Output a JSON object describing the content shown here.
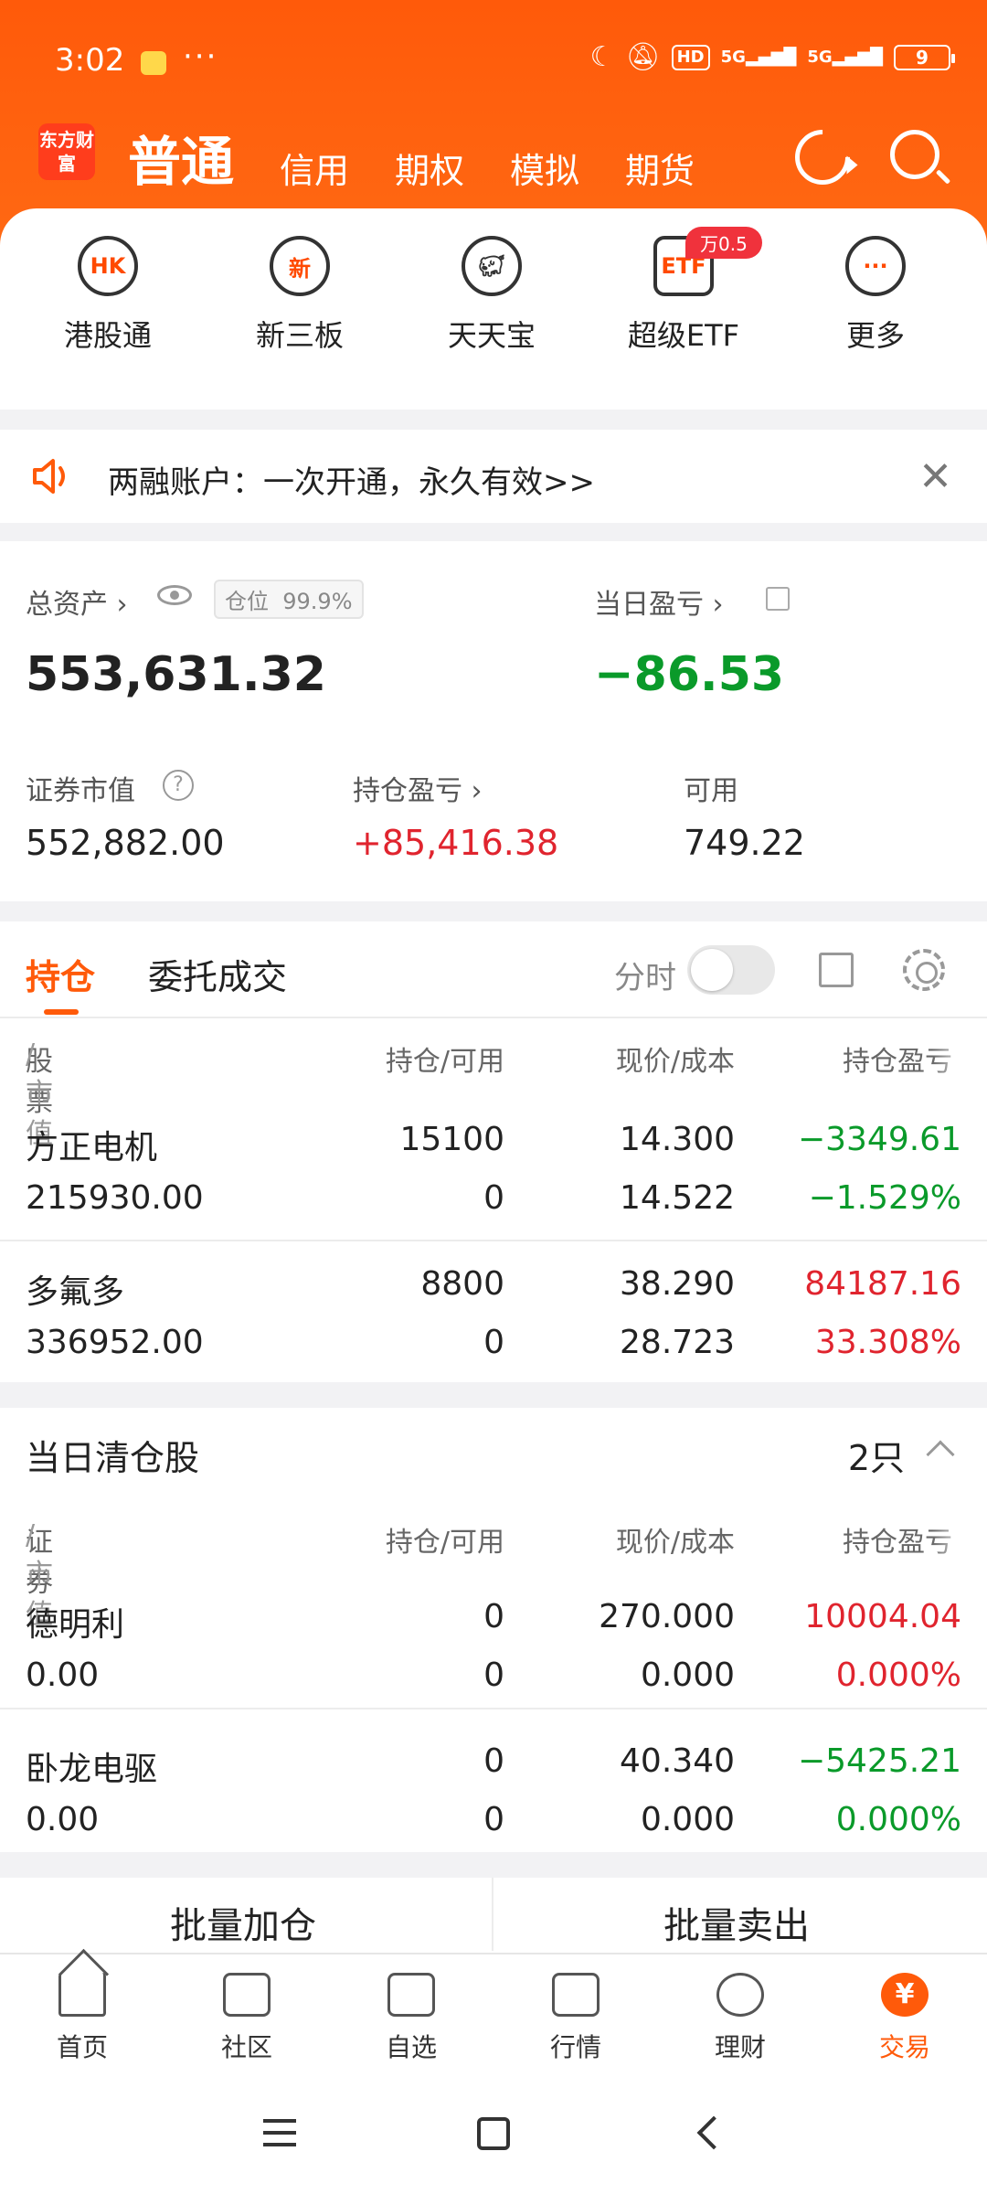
{
  "status_bar": {
    "time": "3:02",
    "dots": "···",
    "hd": "HD",
    "signal1": "5G",
    "signal2": "5G",
    "battery": "9"
  },
  "top_nav": {
    "logo": "东方财富",
    "tabs": [
      "普通",
      "信用",
      "期权",
      "模拟",
      "期货"
    ]
  },
  "quick_actions": [
    {
      "label": "港股通",
      "icon": "HK"
    },
    {
      "label": "新三板",
      "icon": "新"
    },
    {
      "label": "天天宝",
      "icon": "piggy-bank"
    },
    {
      "label": "超级ETF",
      "icon": "ETF",
      "badge": "万0.5"
    },
    {
      "label": "更多",
      "icon": "···"
    }
  ],
  "notice": {
    "text": "两融账户：一次开通，永久有效>>"
  },
  "assets": {
    "total_label": "总资产",
    "position_tag": "仓位",
    "position_value": "99.9%",
    "total_value": "553,631.32",
    "daily_pl_label": "当日盈亏",
    "daily_pl_value": "−86.53",
    "market_value_label": "证券市值",
    "market_value": "552,882.00",
    "holding_pl_label": "持仓盈亏",
    "holding_pl_value": "+85,416.38",
    "available_label": "可用",
    "available_value": "749.22"
  },
  "positions": {
    "tab_holdings": "持仓",
    "tab_orders": "委托成交",
    "fenshi_label": "分时",
    "headers": {
      "c1": "股票",
      "c1_suffix": "/市值",
      "c2": "持仓/可用",
      "c3": "现价/成本",
      "c4": "持仓盈亏"
    },
    "rows": [
      {
        "name": "方正电机",
        "market_value": "215930.00",
        "holding": "15100",
        "available": "0",
        "price": "14.300",
        "cost": "14.522",
        "pl": "−3349.61",
        "pl_pct": "−1.529%",
        "trend": "down"
      },
      {
        "name": "多氟多",
        "market_value": "336952.00",
        "holding": "8800",
        "available": "0",
        "price": "38.290",
        "cost": "28.723",
        "pl": "84187.16",
        "pl_pct": "33.308%",
        "trend": "up"
      }
    ]
  },
  "cleared": {
    "title": "当日清仓股",
    "count": "2只",
    "headers": {
      "c1": "证券",
      "c1_suffix": "/市值",
      "c2": "持仓/可用",
      "c3": "现价/成本",
      "c4": "持仓盈亏"
    },
    "rows": [
      {
        "name": "德明利",
        "market_value": "0.00",
        "holding": "0",
        "available": "0",
        "price": "270.000",
        "cost": "0.000",
        "pl": "10004.04",
        "pl_pct": "0.000%",
        "trend": "up"
      },
      {
        "name": "卧龙电驱",
        "market_value": "0.00",
        "holding": "0",
        "available": "0",
        "price": "40.340",
        "cost": "0.000",
        "pl": "−5425.21",
        "pl_pct": "0.000%",
        "trend": "down"
      }
    ]
  },
  "batch": {
    "add": "批量加仓",
    "sell": "批量卖出"
  },
  "bottom_nav": [
    "首页",
    "社区",
    "自选",
    "行情",
    "理财",
    "交易"
  ],
  "colors": {
    "accent": "#ff5a0a",
    "up": "#e0242e",
    "down": "#0a9a2a"
  }
}
